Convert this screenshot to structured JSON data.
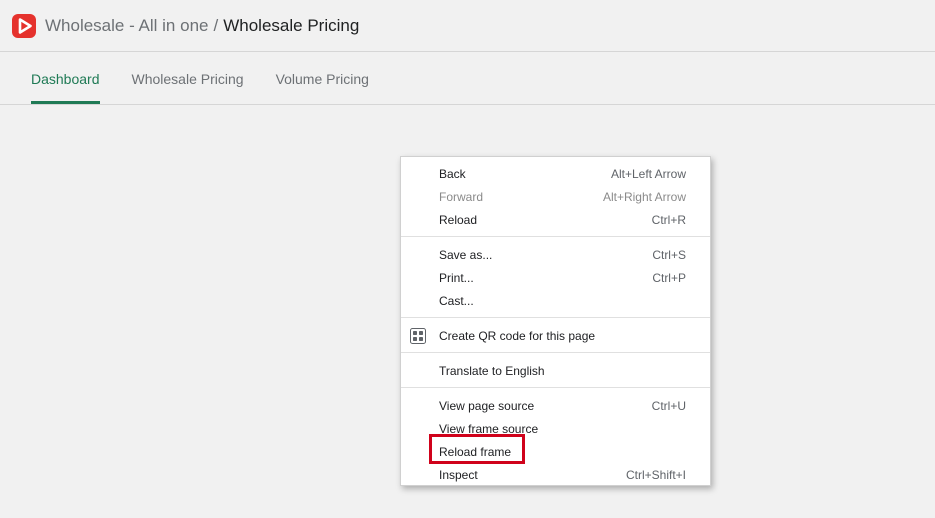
{
  "header": {
    "app_name": "Wholesale - All in one",
    "separator": "/",
    "page_title": "Wholesale Pricing",
    "logo_icon": "app-logo-icon",
    "brand_color": "#e5322d"
  },
  "tabs": [
    {
      "label": "Dashboard",
      "active": true
    },
    {
      "label": "Wholesale Pricing",
      "active": false
    },
    {
      "label": "Volume Pricing",
      "active": false
    }
  ],
  "accent_color": "#1f7a55",
  "context_menu": {
    "groups": [
      [
        {
          "label": "Back",
          "shortcut": "Alt+Left Arrow",
          "disabled": false
        },
        {
          "label": "Forward",
          "shortcut": "Alt+Right Arrow",
          "disabled": true
        },
        {
          "label": "Reload",
          "shortcut": "Ctrl+R",
          "disabled": false
        }
      ],
      [
        {
          "label": "Save as...",
          "shortcut": "Ctrl+S",
          "disabled": false
        },
        {
          "label": "Print...",
          "shortcut": "Ctrl+P",
          "disabled": false
        },
        {
          "label": "Cast...",
          "shortcut": "",
          "disabled": false
        }
      ],
      [
        {
          "label": "Create QR code for this page",
          "shortcut": "",
          "disabled": false,
          "icon": "qr-code-icon"
        }
      ],
      [
        {
          "label": "Translate to English",
          "shortcut": "",
          "disabled": false
        }
      ],
      [
        {
          "label": "View page source",
          "shortcut": "Ctrl+U",
          "disabled": false
        },
        {
          "label": "View frame source",
          "shortcut": "",
          "disabled": false
        },
        {
          "label": "Reload frame",
          "shortcut": "",
          "disabled": false,
          "highlighted": true
        },
        {
          "label": "Inspect",
          "shortcut": "Ctrl+Shift+I",
          "disabled": false
        }
      ]
    ],
    "highlight_color": "#d0021b"
  }
}
